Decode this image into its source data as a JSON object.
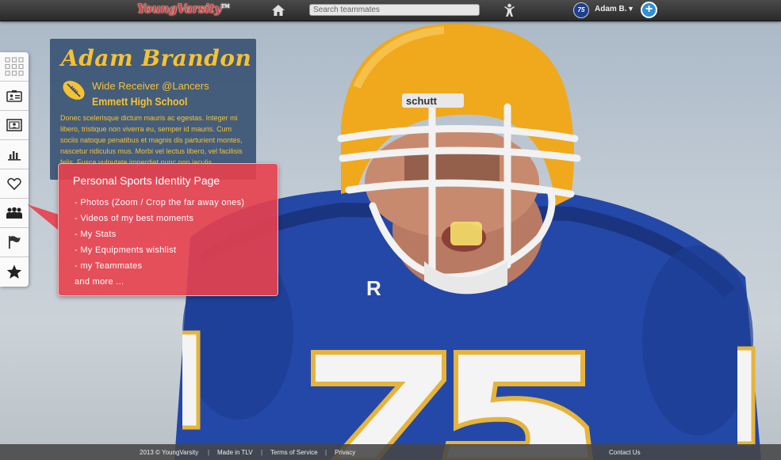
{
  "header": {
    "logo_text": "YoungVarsity",
    "logo_tm": "TM",
    "search_placeholder": "Search teammates",
    "user_name": "Adam B.",
    "user_caret": "▼",
    "avatar_number": "75",
    "add_label": "+"
  },
  "sidebar": {
    "items": [
      {
        "icon": "grid-icon"
      },
      {
        "icon": "id-card-icon"
      },
      {
        "icon": "profile-card-icon"
      },
      {
        "icon": "stats-icon"
      },
      {
        "icon": "heart-icon"
      },
      {
        "icon": "team-icon"
      },
      {
        "icon": "flag-icon"
      },
      {
        "icon": "star-icon"
      }
    ]
  },
  "profile": {
    "name": "Adam Brandon",
    "position": "Wide Receiver @Lancers",
    "school": "Emmett High School",
    "bio": "Donec scelerisque dictum mauris ac egestas. Integer mi libero, tristique non viverra eu, semper id mauris. Cum sociis natoque penatibus et magnis dis parturient montes, nascetur ridiculus mus. Morbi vel lectus libero, vel facilisis felis. Fusce vulputate imperdiet nunc non iaculis."
  },
  "callout": {
    "title": "Personal Sports Identity Page",
    "items": [
      "- Photos (Zoom / Crop the far away ones)",
      "- Videos of my best moments",
      "- My Stats",
      "- My Equipments wishlist",
      "- my Teammates",
      "and more ..."
    ]
  },
  "footer": {
    "copyright": "2013 © YoungVarsity",
    "made_in": "Made in TLV",
    "terms": "Terms of Service",
    "privacy": "Privacy",
    "contact": "Contact Us",
    "separator": "|"
  },
  "colors": {
    "accent_gold": "#f6c232",
    "card_blue": "#344e70",
    "callout_red": "#e8404c",
    "logo_red": "#e23a3a",
    "add_blue": "#2f8fd8"
  }
}
